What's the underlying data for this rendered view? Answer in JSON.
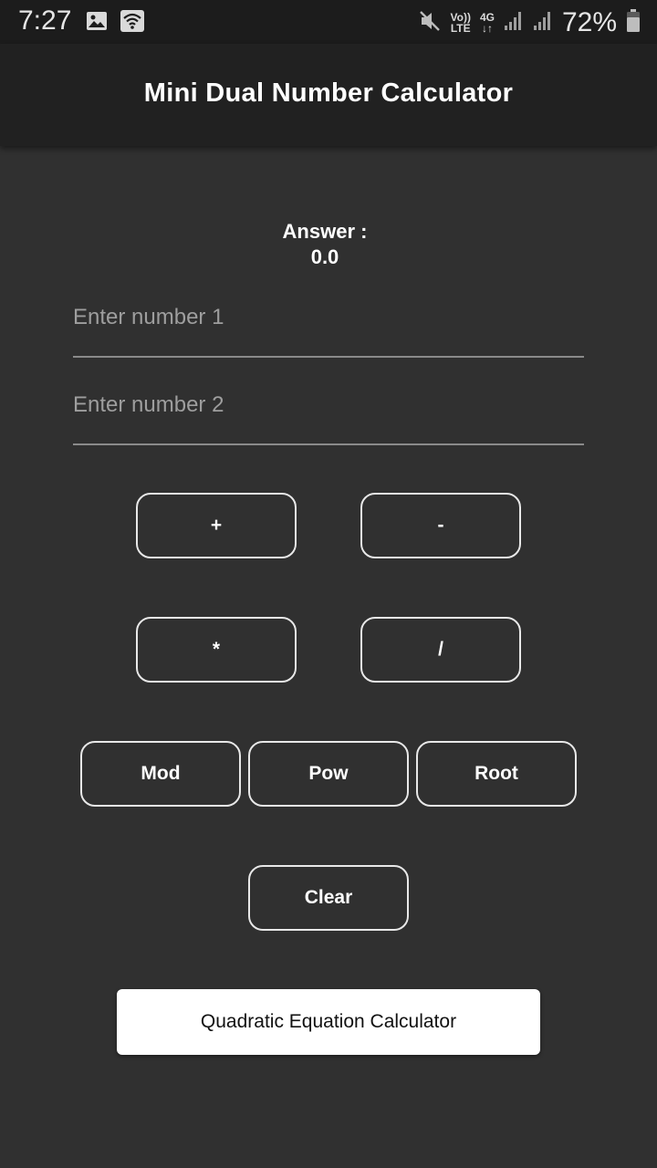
{
  "status_bar": {
    "time": "7:27",
    "network_top": "Vo))",
    "network_bottom": "LTE",
    "data_top": "4G",
    "data_bottom": "↓↑",
    "battery": "72%"
  },
  "app_bar": {
    "title": "Mini Dual Number Calculator"
  },
  "answer": {
    "label": "Answer :",
    "value": "0.0"
  },
  "inputs": {
    "number1_placeholder": "Enter number 1",
    "number2_placeholder": "Enter number 2",
    "number1_value": "",
    "number2_value": ""
  },
  "buttons": {
    "add": "+",
    "subtract": "-",
    "multiply": "*",
    "divide": "/",
    "mod": "Mod",
    "pow": "Pow",
    "root": "Root",
    "clear": "Clear",
    "quadratic": "Quadratic Equation Calculator"
  },
  "colors": {
    "background": "#303030",
    "app_bar": "#212121",
    "status_bar": "#1c1c1c",
    "button_border": "#e8e8e8"
  }
}
